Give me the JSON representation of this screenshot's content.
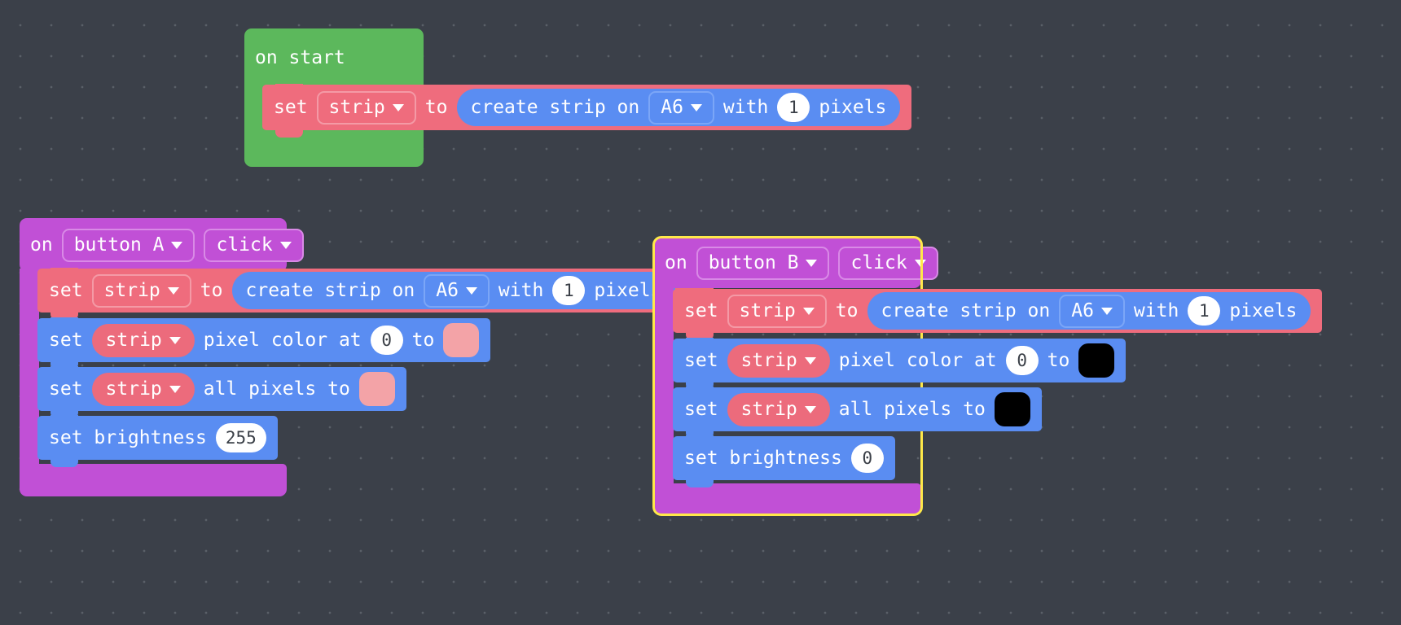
{
  "editor": {
    "name": "makecode-blocks-workspace",
    "background_color": "#3b4049",
    "grid_dot_color": "#5a6068"
  },
  "palette": {
    "event_green": "#5cb85c",
    "event_purple": "#c150d6",
    "variable_pink": "#ef6c7d",
    "light_blue": "#5a8df2",
    "selection_yellow": "#ffe949",
    "swatch_pink": "#f3a3a7",
    "swatch_black": "#000000",
    "field_white": "#ffffff"
  },
  "scripts": [
    {
      "id": "on-start-script",
      "hat": {
        "label": "on start",
        "color": "#5cb85c"
      },
      "rows": [
        {
          "type": "set-variable",
          "set_label": "set",
          "variable": "strip",
          "to_label": "to",
          "reporter": {
            "prefix": "create strip on",
            "pin": "A6",
            "with_label": "with",
            "count": "1",
            "suffix": "pixels"
          }
        }
      ]
    },
    {
      "id": "on-button-a-click-script",
      "selected": false,
      "hat": {
        "on_label": "on",
        "source": "button A",
        "event": "click",
        "color": "#c150d6"
      },
      "rows": [
        {
          "type": "set-variable",
          "set_label": "set",
          "variable": "strip",
          "to_label": "to",
          "reporter": {
            "prefix": "create strip on",
            "pin": "A6",
            "with_label": "with",
            "count": "1",
            "suffix": "pixels"
          }
        },
        {
          "type": "set-pixel-color",
          "set_label": "set",
          "variable": "strip",
          "mid_label": "pixel color at",
          "index": "0",
          "to_label": "to",
          "color": "#f3a3a7"
        },
        {
          "type": "set-all-pixels",
          "set_label": "set",
          "variable": "strip",
          "mid_label": "all pixels to",
          "color": "#f3a3a7"
        },
        {
          "type": "set-brightness",
          "label": "set brightness",
          "value": "255"
        }
      ]
    },
    {
      "id": "on-button-b-click-script",
      "selected": true,
      "hat": {
        "on_label": "on",
        "source": "button B",
        "event": "click",
        "color": "#c150d6"
      },
      "rows": [
        {
          "type": "set-variable",
          "set_label": "set",
          "variable": "strip",
          "to_label": "to",
          "reporter": {
            "prefix": "create strip on",
            "pin": "A6",
            "with_label": "with",
            "count": "1",
            "suffix": "pixels"
          }
        },
        {
          "type": "set-pixel-color",
          "set_label": "set",
          "variable": "strip",
          "mid_label": "pixel color at",
          "index": "0",
          "to_label": "to",
          "color": "#000000"
        },
        {
          "type": "set-all-pixels",
          "set_label": "set",
          "variable": "strip",
          "mid_label": "all pixels to",
          "color": "#000000"
        },
        {
          "type": "set-brightness",
          "label": "set brightness",
          "value": "0"
        }
      ]
    }
  ]
}
